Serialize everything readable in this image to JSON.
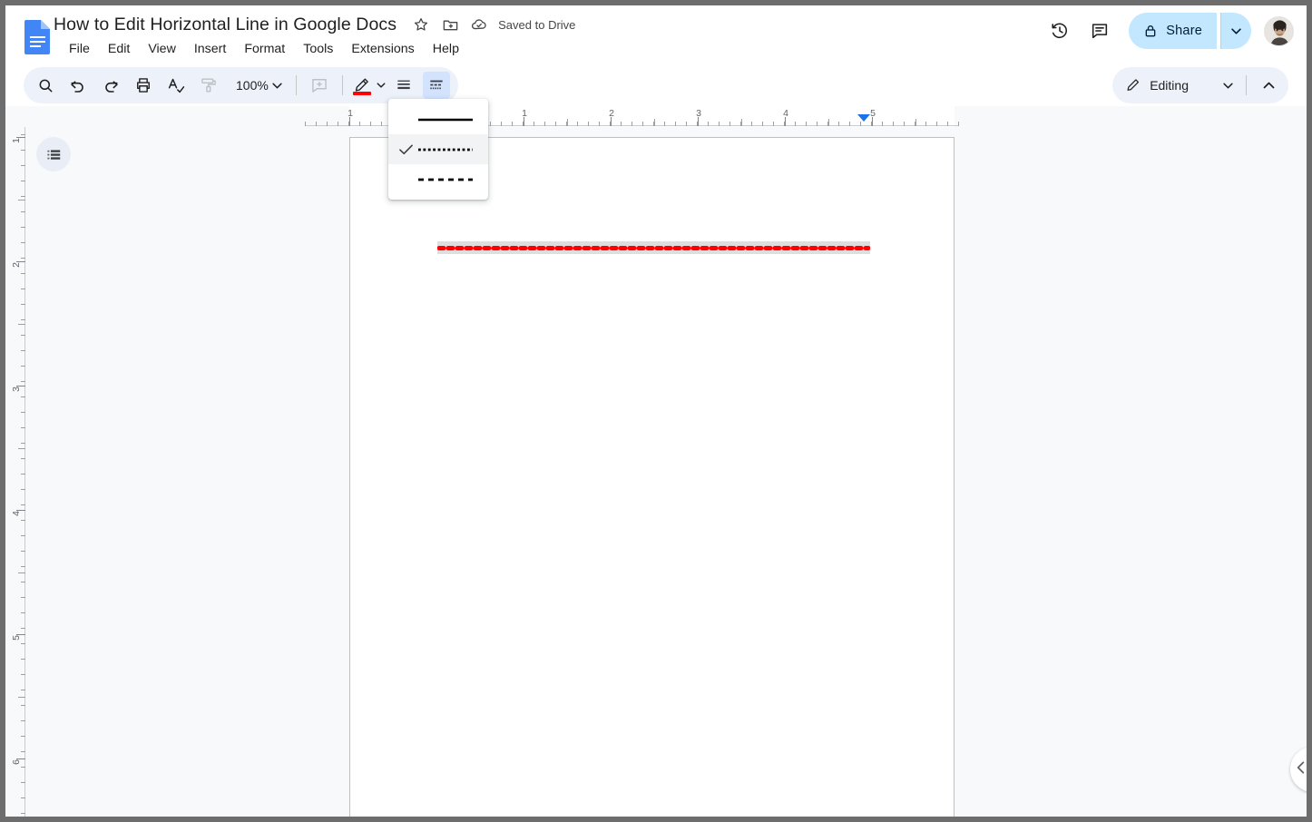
{
  "header": {
    "doc_title": "How to Edit Horizontal Line in Google Docs",
    "saved_status": "Saved to Drive",
    "icons": {
      "logo": "google-docs-logo",
      "star": "star-icon",
      "move_folder": "move-to-folder-icon",
      "cloud": "cloud-saved-icon",
      "history": "version-history-icon",
      "comments": "comments-icon"
    },
    "menu": [
      {
        "label": "File"
      },
      {
        "label": "Edit"
      },
      {
        "label": "View"
      },
      {
        "label": "Insert"
      },
      {
        "label": "Format"
      },
      {
        "label": "Tools"
      },
      {
        "label": "Extensions"
      },
      {
        "label": "Help"
      }
    ],
    "share": {
      "label": "Share",
      "lock_icon": "lock-icon",
      "caret_icon": "chevron-down-icon",
      "bg_color": "#c2e7ff",
      "text_color": "#001d35"
    }
  },
  "toolbar": {
    "search_label": "search-icon",
    "undo_label": "undo-icon",
    "redo_label": "redo-icon",
    "print_label": "print-icon",
    "spelling_label": "spelling-check-icon",
    "paint_format_label": "paint-format-icon",
    "zoom_value": "100%",
    "zoom_caret": "chevron-down-icon",
    "add_comment_label": "add-comment-icon",
    "border_color_label": "border-color-pen-icon",
    "border_color_swatch": "#ff0000",
    "border_weight_label": "border-weight-icon",
    "border_dash_label": "border-dash-icon",
    "border_dash_active": true
  },
  "mode": {
    "pencil_icon": "pencil-icon",
    "label": "Editing",
    "caret_icon": "chevron-down-icon",
    "collapse_icon": "chevron-up-icon"
  },
  "dropdown": {
    "name": "border-dash-menu",
    "items": [
      {
        "style": "solid",
        "label": "Solid line",
        "selected": false,
        "check_icon": ""
      },
      {
        "style": "dotted",
        "label": "Dotted line",
        "selected": true,
        "check_icon": "checkmark-icon"
      },
      {
        "style": "dashed",
        "label": "Dashed line",
        "selected": false,
        "check_icon": ""
      }
    ]
  },
  "ruler": {
    "horizontal_numbers": [
      "1",
      "1",
      "2",
      "3",
      "4",
      "5"
    ],
    "vertical_numbers": [
      "1",
      "2",
      "3",
      "4",
      "5",
      "6"
    ],
    "indent_marker": "left-indent-marker"
  },
  "document": {
    "outline_button": "document-outline-icon",
    "horizontal_line": {
      "name": "horizontal-rule",
      "color": "#ff0000",
      "style": "dotted",
      "selected": true,
      "selection_bg": "#dedede"
    }
  },
  "panel": {
    "collapse_icon": "chevron-left-icon"
  }
}
